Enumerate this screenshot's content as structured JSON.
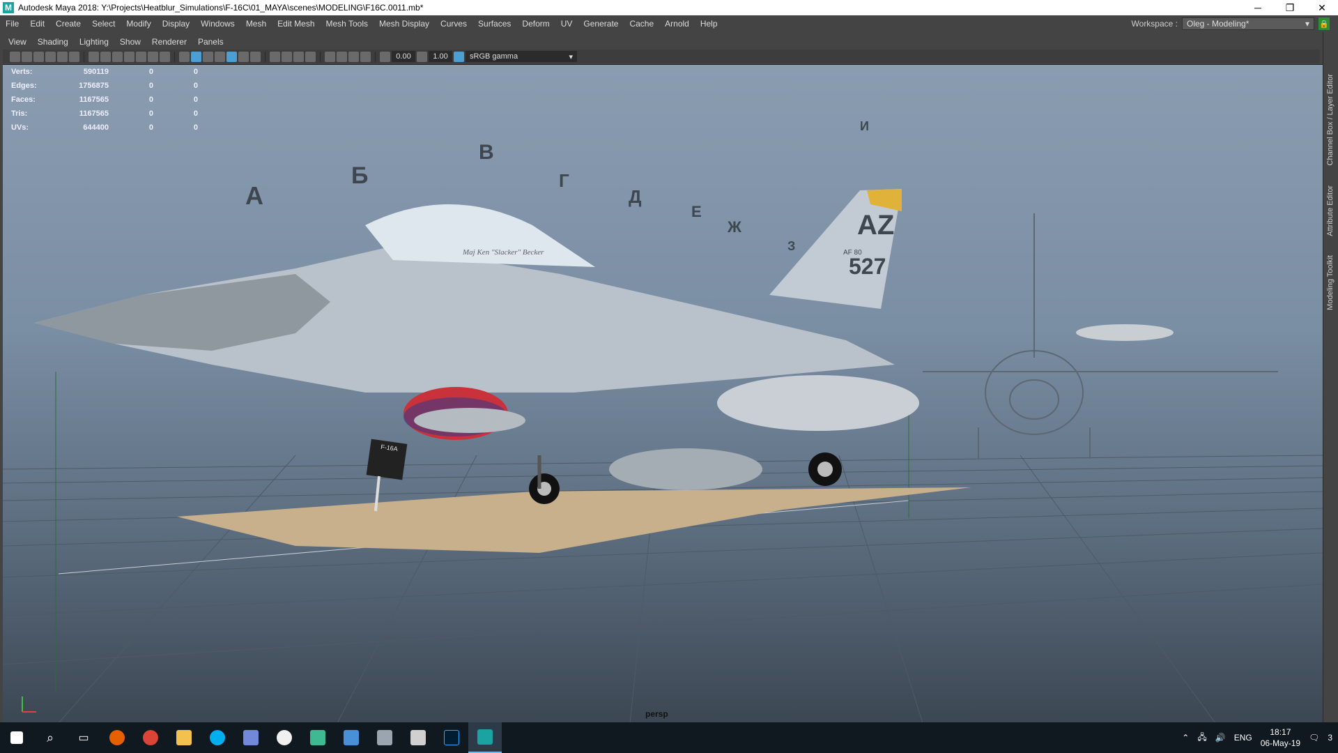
{
  "window": {
    "title": "Autodesk Maya 2018: Y:\\Projects\\Heatblur_Simulations\\F-16C\\01_MAYA\\scenes\\MODELING\\F16C.0011.mb*",
    "minimize_label": "─",
    "restore_label": "❐",
    "close_label": "✕"
  },
  "menubar": {
    "items": [
      "File",
      "Edit",
      "Create",
      "Select",
      "Modify",
      "Display",
      "Windows",
      "Mesh",
      "Edit Mesh",
      "Mesh Tools",
      "Mesh Display",
      "Curves",
      "Surfaces",
      "Deform",
      "UV",
      "Generate",
      "Cache",
      "Arnold",
      "Help"
    ],
    "workspace_label": "Workspace :",
    "workspace_value": "Oleg - Modeling*"
  },
  "panel_menu": {
    "items": [
      "View",
      "Shading",
      "Lighting",
      "Show",
      "Renderer",
      "Panels"
    ]
  },
  "panel_toolbar": {
    "exposure": "0.00",
    "gamma_value": "1.00",
    "color_space": "sRGB gamma"
  },
  "hud": {
    "rows": [
      {
        "label": "Verts:",
        "value": "590119",
        "c1": "0",
        "c2": "0"
      },
      {
        "label": "Edges:",
        "value": "1756875",
        "c1": "0",
        "c2": "0"
      },
      {
        "label": "Faces:",
        "value": "1167565",
        "c1": "0",
        "c2": "0"
      },
      {
        "label": "Tris:",
        "value": "1167565",
        "c1": "0",
        "c2": "0"
      },
      {
        "label": "UVs:",
        "value": "644400",
        "c1": "0",
        "c2": "0"
      }
    ]
  },
  "viewport": {
    "camera": "persp",
    "reference_letters": [
      "А",
      "Б",
      "В",
      "Г",
      "Д",
      "Е",
      "Ж",
      "З",
      "И"
    ],
    "tail_code": "AZ",
    "tail_number": "527",
    "tail_small": "AF 80",
    "pilot_name": "Maj Ken \"Slacker\" Becker",
    "sign_title": "F-16A"
  },
  "right_dock": {
    "tabs": [
      "Channel Box / Layer Editor",
      "Attribute Editor",
      "Modeling Toolkit"
    ]
  },
  "taskbar": {
    "apps": [
      "windows-start",
      "search",
      "task-view",
      "firefox",
      "chrome",
      "file-explorer",
      "skype",
      "discord",
      "itunes",
      "slack",
      "photos",
      "vmware",
      "calculator",
      "photoshop",
      "maya"
    ],
    "language": "ENG",
    "time": "18:17",
    "date": "06-May-19",
    "notifications": "3"
  },
  "colors": {
    "viewport_top": "#8a9cb0",
    "viewport_bottom": "#3c4753",
    "ui_bg": "#444444",
    "accent": "#4a9fd4"
  }
}
